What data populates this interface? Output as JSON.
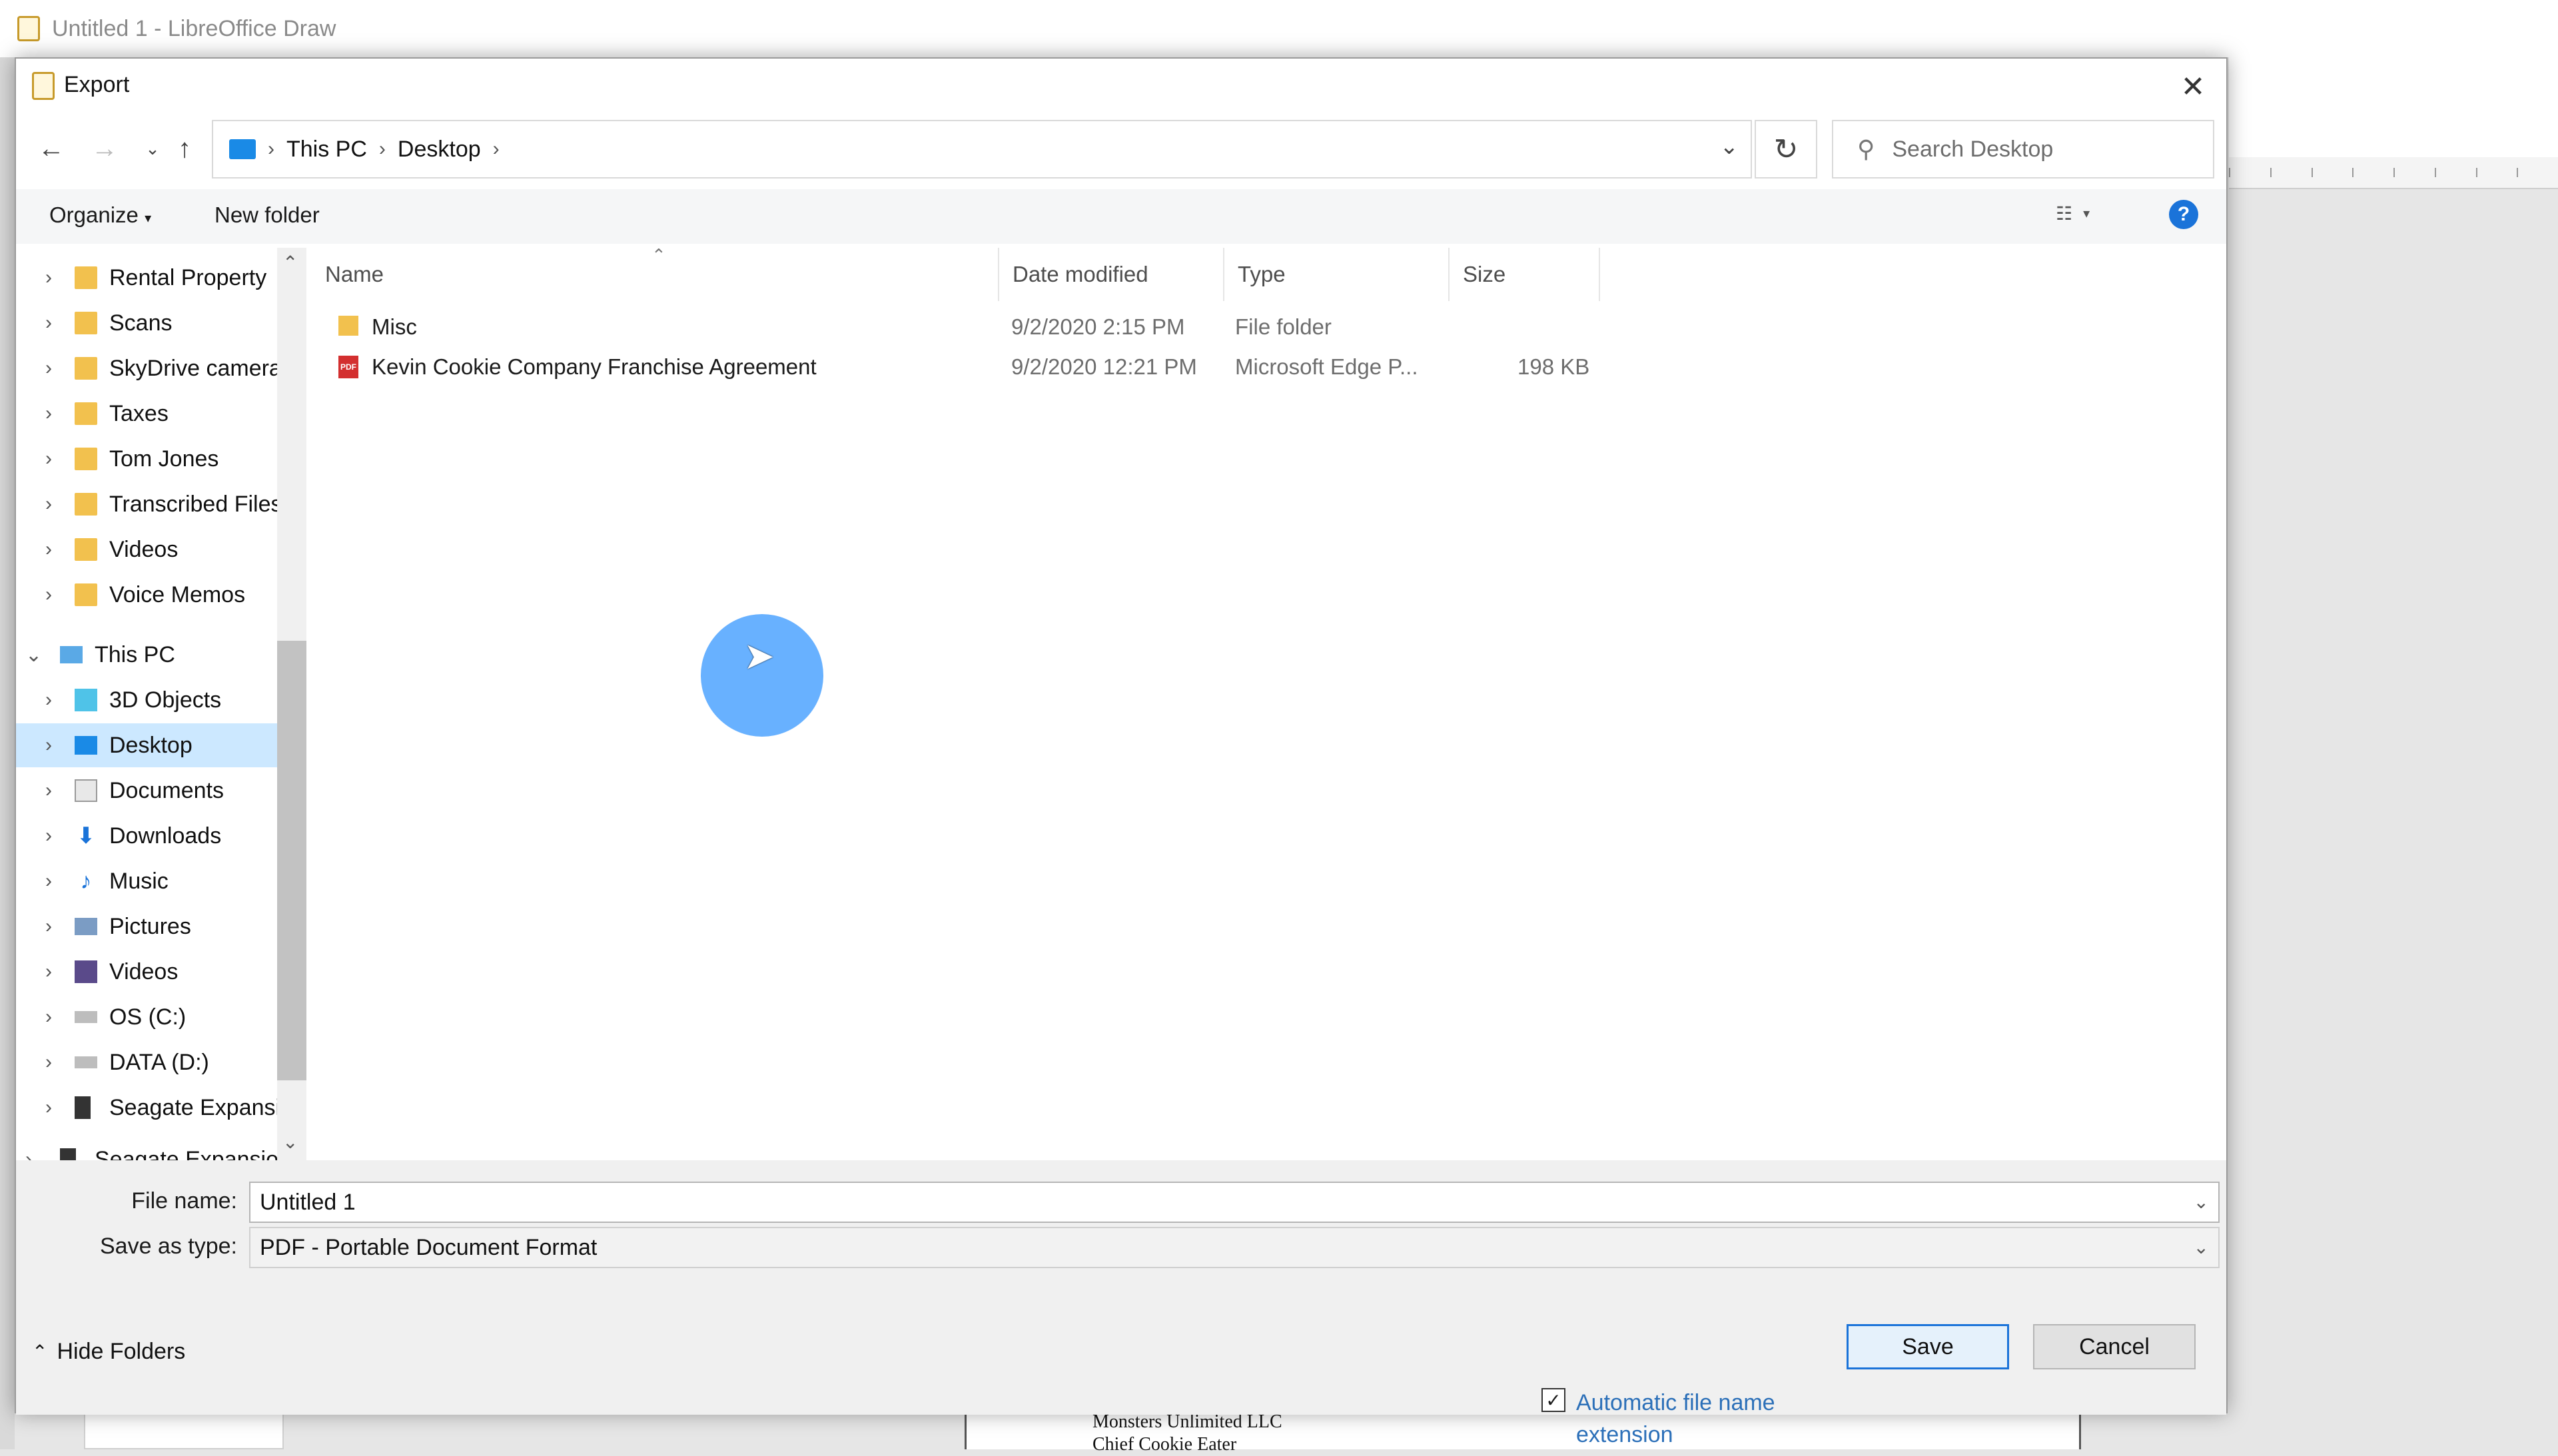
{
  "app": {
    "title": "Untitled 1 - LibreOffice Draw"
  },
  "background_doc": {
    "line1": "Monsters Unlimited LLC",
    "line2": "Chief Cookie Eater"
  },
  "dialog": {
    "title": "Export",
    "address": {
      "crumbs": [
        "This PC",
        "Desktop"
      ]
    },
    "search": {
      "placeholder": "Search Desktop"
    },
    "toolbar": {
      "organize": "Organize",
      "new_folder": "New folder",
      "help": "?"
    },
    "nav": {
      "items": [
        {
          "label": "Rental Property",
          "icon": "folder-icon"
        },
        {
          "label": "Scans",
          "icon": "folder-icon"
        },
        {
          "label": "SkyDrive camera",
          "icon": "folder-icon"
        },
        {
          "label": "Taxes",
          "icon": "folder-icon"
        },
        {
          "label": "Tom Jones",
          "icon": "folder-icon"
        },
        {
          "label": "Transcribed Files",
          "icon": "folder-icon"
        },
        {
          "label": "Videos",
          "icon": "folder-icon"
        },
        {
          "label": "Voice Memos",
          "icon": "folder-icon"
        },
        {
          "label": "This PC",
          "icon": "computer-icon"
        },
        {
          "label": "3D Objects",
          "icon": "3d-objects-icon"
        },
        {
          "label": "Desktop",
          "icon": "desktop-icon",
          "selected": true
        },
        {
          "label": "Documents",
          "icon": "documents-icon"
        },
        {
          "label": "Downloads",
          "icon": "downloads-icon"
        },
        {
          "label": "Music",
          "icon": "music-icon"
        },
        {
          "label": "Pictures",
          "icon": "pictures-icon"
        },
        {
          "label": "Videos",
          "icon": "videos-icon"
        },
        {
          "label": "OS (C:)",
          "icon": "drive-icon"
        },
        {
          "label": "DATA (D:)",
          "icon": "drive-icon"
        },
        {
          "label": "Seagate Expansic",
          "icon": "external-drive-icon"
        },
        {
          "label": "Seagate Expansion",
          "icon": "external-drive-icon"
        }
      ]
    },
    "columns": {
      "name": "Name",
      "date": "Date modified",
      "type": "Type",
      "size": "Size"
    },
    "files": [
      {
        "name": "Misc",
        "date": "9/2/2020 2:15 PM",
        "type": "File folder",
        "size": "",
        "icon": "folder-icon"
      },
      {
        "name": "Kevin Cookie Company Franchise Agreement",
        "date": "9/2/2020 12:21 PM",
        "type": "Microsoft Edge P...",
        "size": "198 KB",
        "icon": "pdf-icon"
      }
    ],
    "form": {
      "file_name_label": "File name:",
      "file_name_value": "Untitled 1",
      "save_type_label": "Save as type:",
      "save_type_value": "PDF - Portable Document Format",
      "auto_ext_label": "Automatic file name extension",
      "auto_ext_checked": true,
      "save": "Save",
      "cancel": "Cancel",
      "hide_folders": "Hide Folders"
    }
  },
  "colors": {
    "accent": "#1a73d9",
    "selection": "#cce8ff",
    "folder": "#f2c14e",
    "click_highlight": "#4da3ff"
  }
}
